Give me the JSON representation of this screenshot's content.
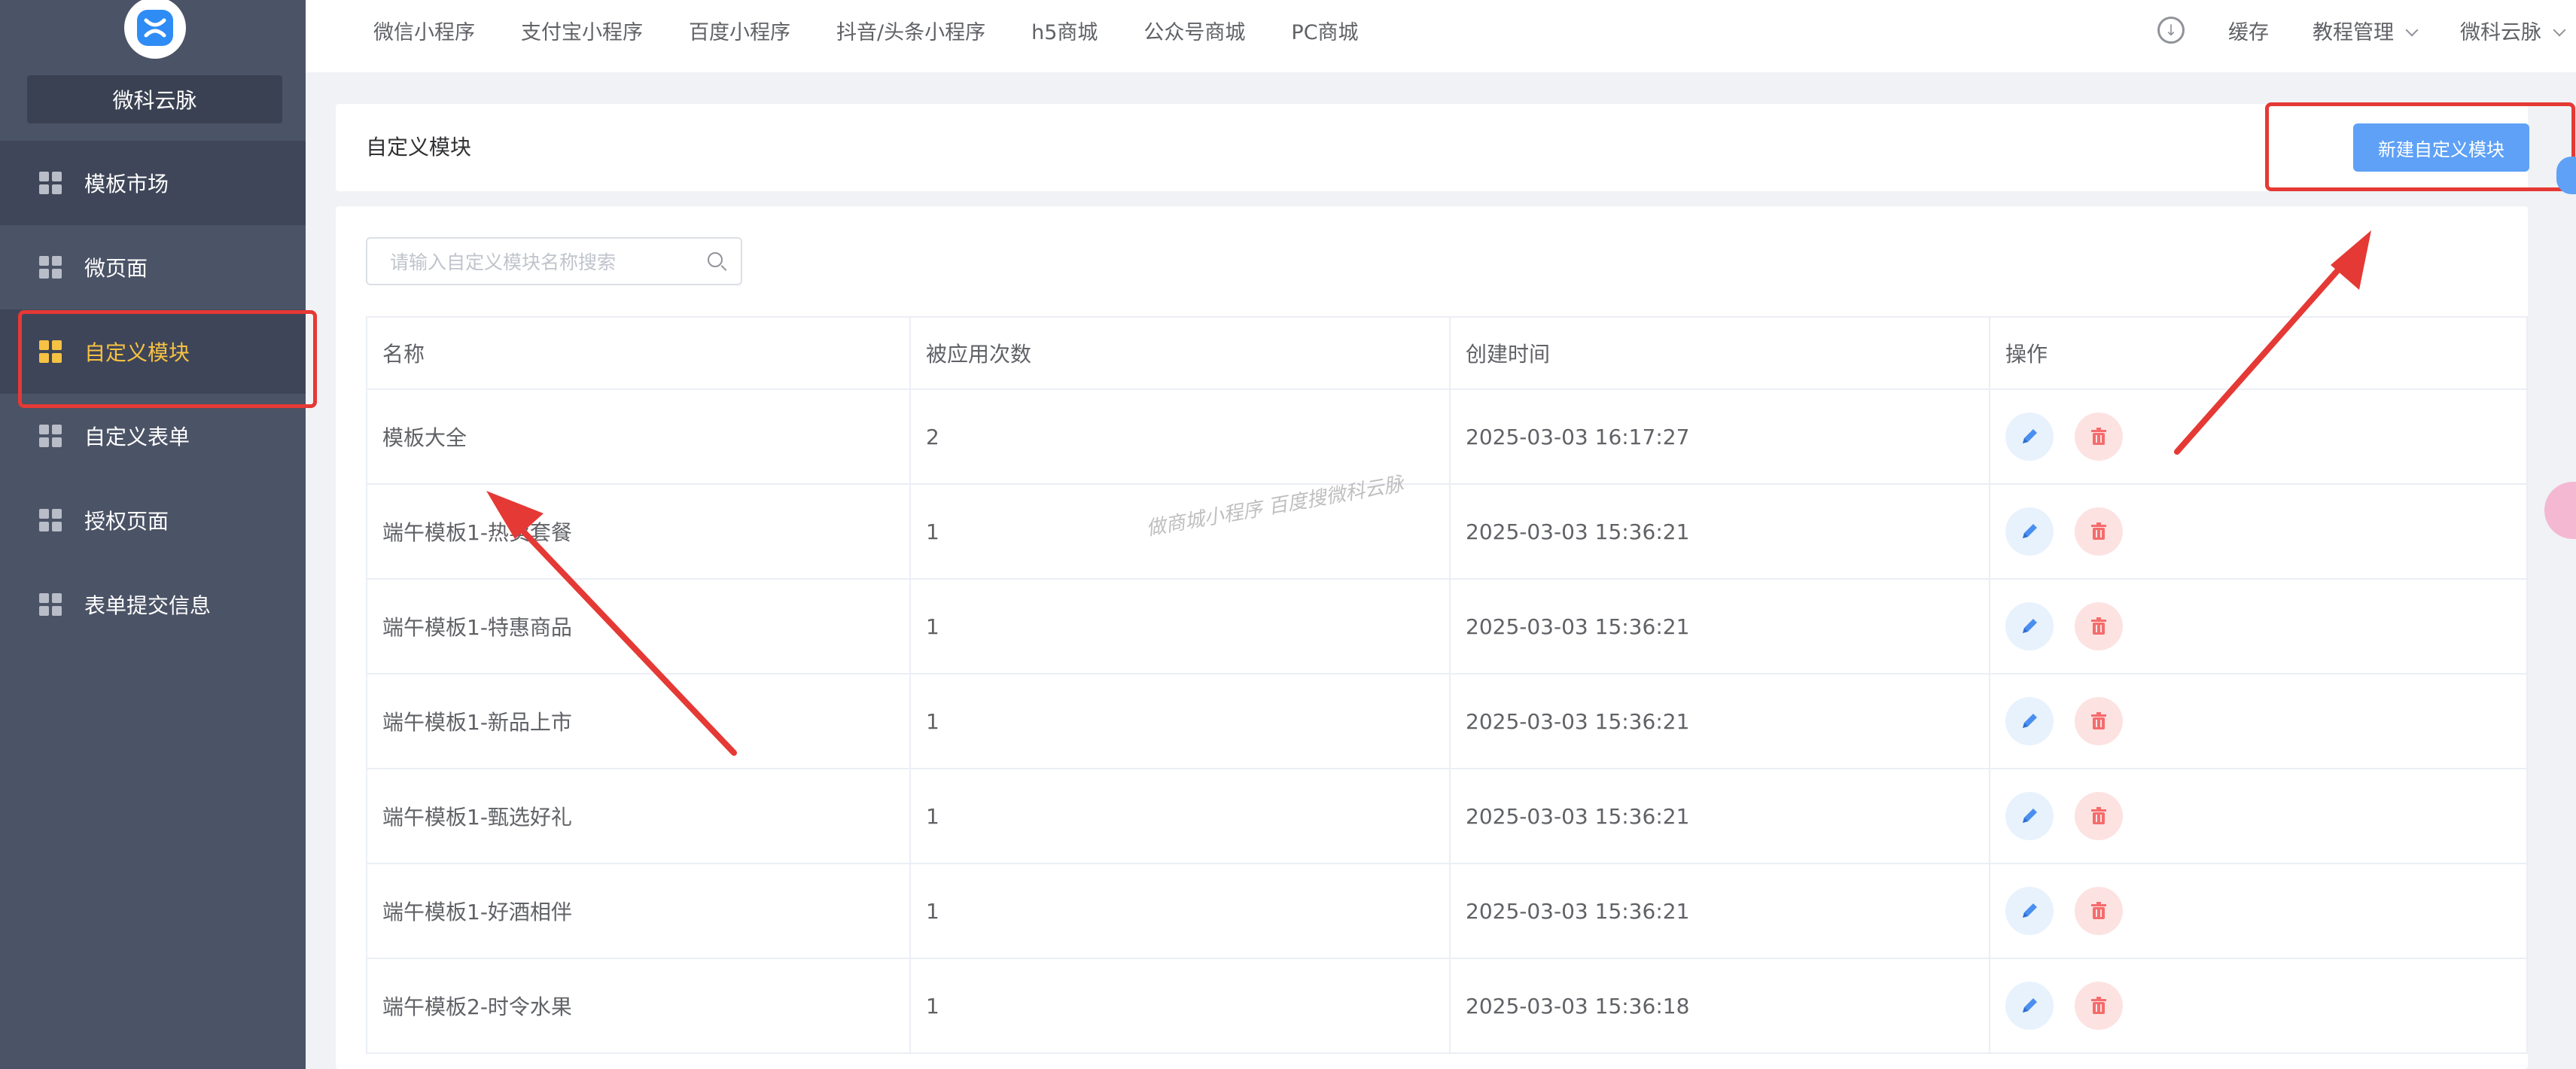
{
  "sidebar": {
    "brand": "微科云脉",
    "items": [
      {
        "label": "模板市场"
      },
      {
        "label": "微页面"
      },
      {
        "label": "自定义模块"
      },
      {
        "label": "自定义表单"
      },
      {
        "label": "授权页面"
      },
      {
        "label": "表单提交信息"
      }
    ],
    "active_index": 2
  },
  "topnav": {
    "items": [
      "微信小程序",
      "支付宝小程序",
      "百度小程序",
      "抖音/头条小程序",
      "h5商城",
      "公众号商城",
      "PC商城"
    ],
    "cache_label": "缓存",
    "tutorial_label": "教程管理",
    "user_label": "微科云脉"
  },
  "header": {
    "title": "自定义模块",
    "new_button": "新建自定义模块"
  },
  "search": {
    "placeholder": "请输入自定义模块名称搜索"
  },
  "table": {
    "columns": [
      "名称",
      "被应用次数",
      "创建时间",
      "操作"
    ],
    "rows": [
      {
        "name": "模板大全",
        "count": "2",
        "created": "2025-03-03 16:17:27"
      },
      {
        "name": "端午模板1-热卖套餐",
        "count": "1",
        "created": "2025-03-03 15:36:21"
      },
      {
        "name": "端午模板1-特惠商品",
        "count": "1",
        "created": "2025-03-03 15:36:21"
      },
      {
        "name": "端午模板1-新品上市",
        "count": "1",
        "created": "2025-03-03 15:36:21"
      },
      {
        "name": "端午模板1-甄选好礼",
        "count": "1",
        "created": "2025-03-03 15:36:21"
      },
      {
        "name": "端午模板1-好酒相伴",
        "count": "1",
        "created": "2025-03-03 15:36:21"
      },
      {
        "name": "端午模板2-时令水果",
        "count": "1",
        "created": "2025-03-03 15:36:18"
      }
    ]
  },
  "watermark": "做商城小程序 百度搜微科云脉",
  "colors": {
    "sidebar_bg": "#4b5366",
    "active": "#f7c143",
    "primary": "#5ea1f6",
    "danger": "#f56c6c",
    "annotation": "#e53935"
  }
}
